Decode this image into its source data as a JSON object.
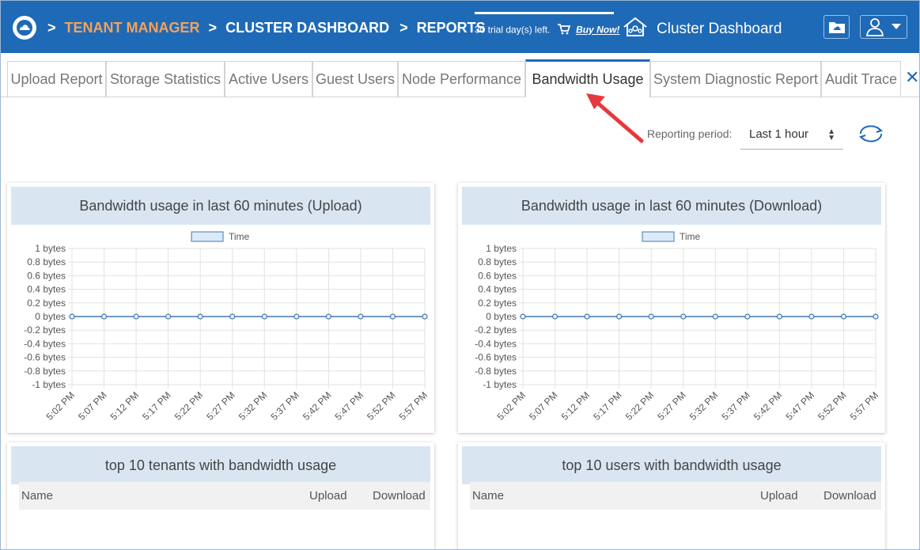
{
  "breadcrumb": {
    "item1": "TENANT MANAGER",
    "item2": "CLUSTER DASHBOARD",
    "item3": "REPORTS",
    "separator": ">"
  },
  "trial": {
    "text": "30 trial day(s) left.",
    "buy_label": "Buy Now!"
  },
  "header": {
    "title": "Cluster Dashboard"
  },
  "tabs": [
    {
      "label": "Upload Report"
    },
    {
      "label": "Storage Statistics"
    },
    {
      "label": "Active Users"
    },
    {
      "label": "Guest Users"
    },
    {
      "label": "Node Performance"
    },
    {
      "label": "Bandwidth Usage",
      "active": true
    },
    {
      "label": "System Diagnostic Report"
    },
    {
      "label": "Audit Trace"
    }
  ],
  "toolbar": {
    "reporting_label": "Reporting period:",
    "period_value": "Last 1 hour"
  },
  "charts": [
    {
      "title": "Bandwidth usage in last 60 minutes (Upload)"
    },
    {
      "title": "Bandwidth usage in last 60 minutes (Download)"
    }
  ],
  "chart_data": [
    {
      "type": "line",
      "title": "Bandwidth usage in last 60 minutes (Upload)",
      "legend": "Time",
      "legend_position": "top-center",
      "y_ticks": [
        "1 bytes",
        "0.8 bytes",
        "0.6 bytes",
        "0.4 bytes",
        "0.2 bytes",
        "0 bytes",
        "-0.2 bytes",
        "-0.4 bytes",
        "-0.6 bytes",
        "-0.8 bytes",
        "-1 bytes"
      ],
      "ylim": [
        -1,
        1
      ],
      "x": [
        "5:02 PM",
        "5:07 PM",
        "5:12 PM",
        "5:17 PM",
        "5:22 PM",
        "5:27 PM",
        "5:32 PM",
        "5:37 PM",
        "5:42 PM",
        "5:47 PM",
        "5:52 PM",
        "5:57 PM"
      ],
      "series": [
        {
          "name": "Time",
          "values": [
            0,
            0,
            0,
            0,
            0,
            0,
            0,
            0,
            0,
            0,
            0,
            0
          ]
        }
      ],
      "grid": true,
      "colors": {
        "line": "#3f78b5",
        "fill": "#dcebf7"
      }
    },
    {
      "type": "line",
      "title": "Bandwidth usage in last 60 minutes (Download)",
      "legend": "Time",
      "legend_position": "top-center",
      "y_ticks": [
        "1 bytes",
        "0.8 bytes",
        "0.6 bytes",
        "0.4 bytes",
        "0.2 bytes",
        "0 bytes",
        "-0.2 bytes",
        "-0.4 bytes",
        "-0.6 bytes",
        "-0.8 bytes",
        "-1 bytes"
      ],
      "ylim": [
        -1,
        1
      ],
      "x": [
        "5:02 PM",
        "5:07 PM",
        "5:12 PM",
        "5:17 PM",
        "5:22 PM",
        "5:27 PM",
        "5:32 PM",
        "5:37 PM",
        "5:42 PM",
        "5:47 PM",
        "5:52 PM",
        "5:57 PM"
      ],
      "series": [
        {
          "name": "Time",
          "values": [
            0,
            0,
            0,
            0,
            0,
            0,
            0,
            0,
            0,
            0,
            0,
            0
          ]
        }
      ],
      "grid": true,
      "colors": {
        "line": "#3f78b5",
        "fill": "#dcebf7"
      }
    }
  ],
  "tables": [
    {
      "title": "top 10 tenants with bandwidth usage",
      "columns": [
        "Name",
        "Upload",
        "Download"
      ]
    },
    {
      "title": "top 10 users with bandwidth usage",
      "columns": [
        "Name",
        "Upload",
        "Download"
      ]
    }
  ],
  "colors": {
    "header_bg": "#1f6ab6",
    "accent_orange": "#f3a25b",
    "annotation_arrow": "#e8383d"
  }
}
